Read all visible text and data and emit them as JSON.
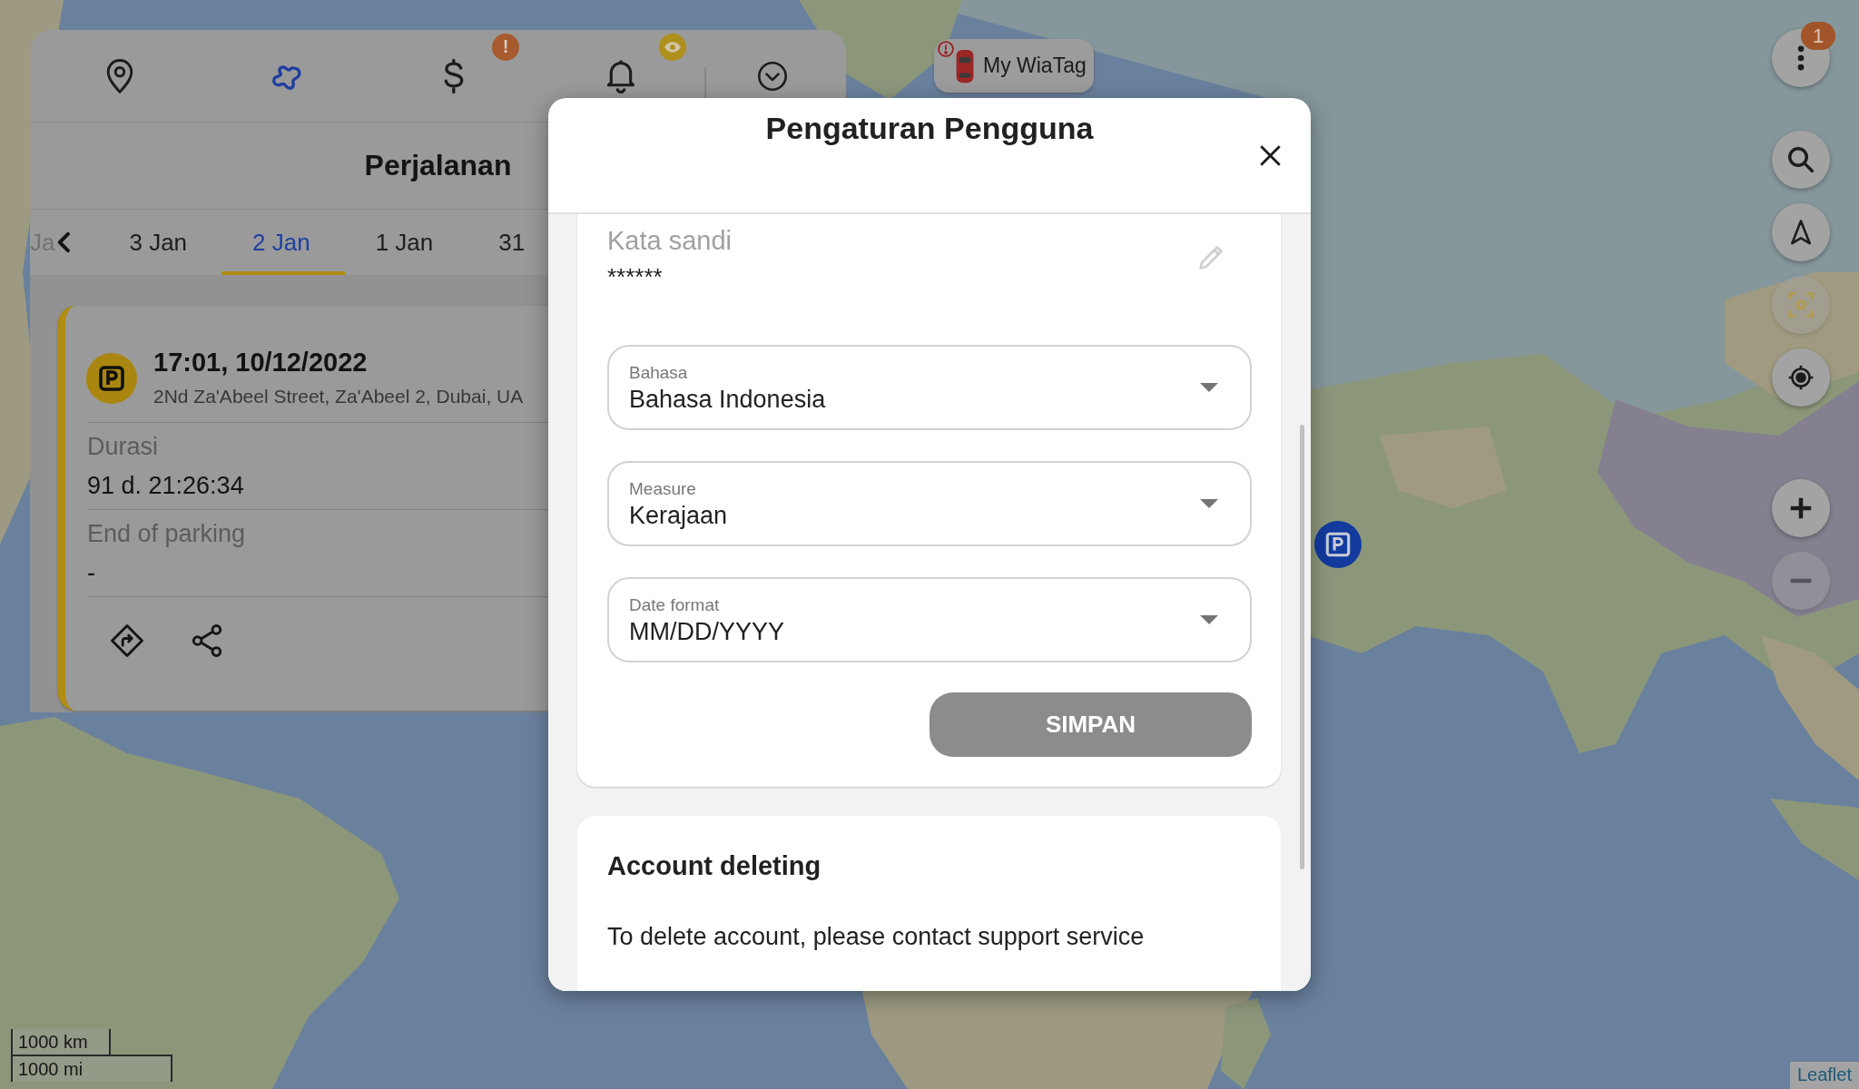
{
  "map": {
    "scale_labels": [
      "1000 km",
      "1000 mi"
    ],
    "attribution": "Leaflet"
  },
  "panel": {
    "nav": [
      {
        "kind": "pin",
        "selected": false
      },
      {
        "kind": "route",
        "selected": true
      },
      {
        "kind": "dollar",
        "selected": false,
        "badge": {
          "kind": "alert",
          "text": "!"
        }
      },
      {
        "kind": "bell",
        "selected": false,
        "badge": {
          "kind": "eye"
        }
      },
      {
        "kind": "chevron",
        "selected": false
      }
    ],
    "title": "Perjalanan",
    "tab_fragment": "Ja",
    "tabs": [
      {
        "label": "3 Jan",
        "selected": false
      },
      {
        "label": "2 Jan",
        "selected": true
      },
      {
        "label": "1 Jan",
        "selected": false
      },
      {
        "label": "31",
        "selected": false
      }
    ],
    "trip": {
      "time": "17:01, 10/12/2022",
      "address": "2Nd Za'Abeel Street, Za'Abeel 2, Dubai, UA",
      "fields": [
        {
          "label": "Durasi",
          "value": "91 d. 21:26:34"
        },
        {
          "label": "End of parking",
          "value": "-"
        }
      ],
      "actions": [
        {
          "kind": "directions"
        },
        {
          "kind": "share"
        }
      ]
    }
  },
  "unit_chip": {
    "name": "My WiaTag",
    "alert": true
  },
  "map_controls": [
    {
      "kind": "more",
      "disabled": false,
      "badge": "1"
    },
    {
      "kind": "search",
      "disabled": false
    },
    {
      "kind": "navigate",
      "disabled": false
    },
    {
      "kind": "focus",
      "disabled": true
    },
    {
      "kind": "locate",
      "disabled": false
    },
    {
      "kind": "zoom_in",
      "disabled": false
    },
    {
      "kind": "zoom_out",
      "disabled": true
    }
  ],
  "dialog": {
    "title": "Pengaturan Pengguna",
    "password": {
      "label": "Kata sandi",
      "value": "******"
    },
    "selects": [
      {
        "label": "Bahasa",
        "value": "Bahasa Indonesia"
      },
      {
        "label": "Measure",
        "value": "Kerajaan"
      },
      {
        "label": "Date format",
        "value": "MM/DD/YYYY"
      }
    ],
    "save_button": {
      "label": "SIMPAN",
      "disabled": true
    },
    "account_deleting": {
      "title": "Account deleting",
      "text": "To delete account, please contact support service"
    }
  }
}
